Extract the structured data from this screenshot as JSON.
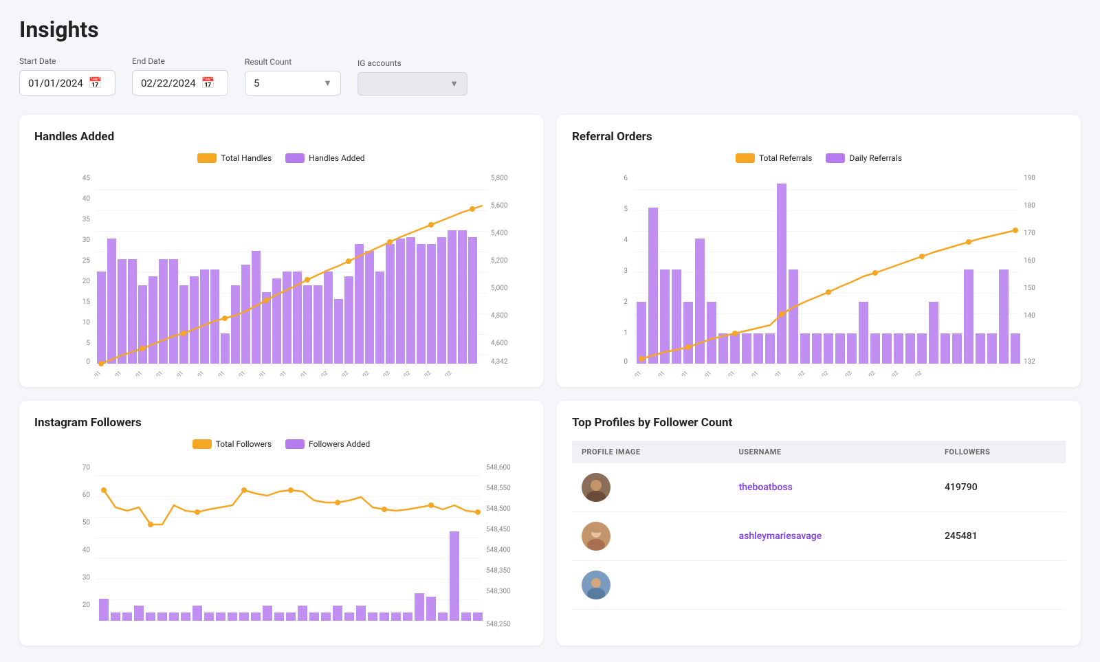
{
  "page": {
    "title": "Insights"
  },
  "filters": {
    "start_date_label": "Start Date",
    "start_date_value": "01/01/2024",
    "end_date_label": "End Date",
    "end_date_value": "02/22/2024",
    "result_count_label": "Result Count",
    "result_count_value": "5",
    "ig_accounts_label": "IG accounts",
    "ig_accounts_value": ""
  },
  "handles_chart": {
    "title": "Handles Added",
    "legend_total": "Total Handles",
    "legend_added": "Handles Added",
    "left_axis": [
      "45",
      "40",
      "35",
      "30",
      "25",
      "20",
      "15",
      "10",
      "5",
      "0"
    ],
    "right_axis": [
      "5,800",
      "5,600",
      "5,400",
      "5,200",
      "5,000",
      "4,800",
      "4,600",
      "4,342"
    ]
  },
  "referral_chart": {
    "title": "Referral Orders",
    "legend_total": "Total Referrals",
    "legend_daily": "Daily Referrals",
    "left_axis": [
      "6",
      "5",
      "4",
      "3",
      "2",
      "1",
      "0"
    ],
    "right_axis": [
      "190",
      "180",
      "170",
      "160",
      "150",
      "140",
      "132"
    ]
  },
  "followers_chart": {
    "title": "Instagram Followers",
    "legend_total": "Total Followers",
    "legend_added": "Followers Added",
    "left_axis": [
      "70",
      "60",
      "50",
      "40",
      "30",
      "20"
    ],
    "right_axis": [
      "548,600",
      "548,550",
      "548,500",
      "548,450",
      "548,400",
      "548,350",
      "548,300",
      "548,250"
    ]
  },
  "top_profiles": {
    "title": "Top Profiles by Follower Count",
    "columns": [
      "PROFILE IMAGE",
      "USERNAME",
      "FOLLOWERS"
    ],
    "rows": [
      {
        "username": "theboatboss",
        "followers": "419790",
        "avatar_color": "avatar-1"
      },
      {
        "username": "ashleymariesavage",
        "followers": "245481",
        "avatar_color": "avatar-2"
      },
      {
        "username": "",
        "followers": "",
        "avatar_color": "avatar-3"
      }
    ]
  }
}
